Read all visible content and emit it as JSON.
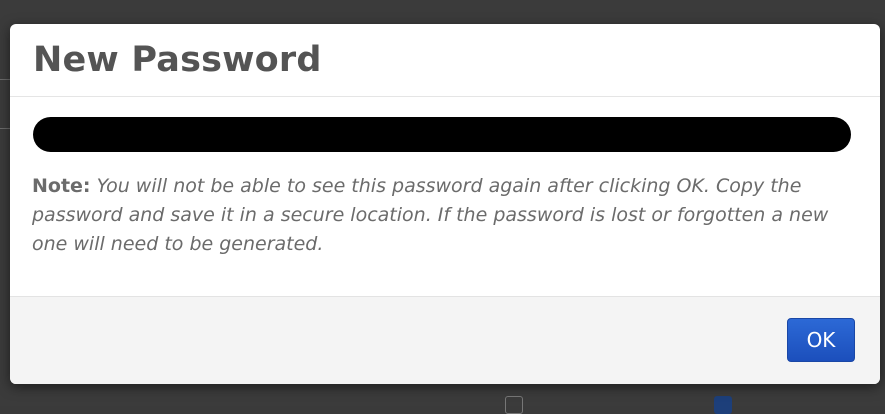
{
  "modal": {
    "title": "New Password",
    "password_value": "",
    "note_label": "Note:",
    "note_text": "You will not be able to see this password again after clicking OK. Copy the password and save it in a secure location. If the password is lost or forgotten a new one will need to be generated.",
    "ok_label": "OK"
  },
  "colors": {
    "overlay": "#3b3b3b",
    "title": "#545454",
    "note_text": "#6b6b6b",
    "password_mask": "#000000",
    "button_primary": "#2c69d6",
    "footer_bg": "#f4f4f4"
  }
}
